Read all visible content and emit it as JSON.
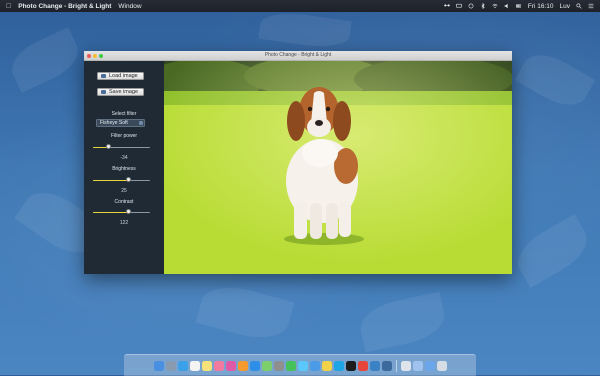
{
  "menubar": {
    "app_name": "Photo Change - Bright & Light",
    "menu_items": [
      "Window"
    ],
    "clock": "Fri 16:10",
    "user": "Luv"
  },
  "window": {
    "title": "Photo Change - Bright & Light"
  },
  "sidebar": {
    "load_label": "Load image",
    "save_label": "Save image",
    "select_filter_label": "Select filter",
    "filter_selected": "Fisheye Soft",
    "filter_power": {
      "label": "Filter power",
      "value": "-34",
      "fraction": 0.28
    },
    "brightness": {
      "label": "Brightness",
      "value": "25",
      "fraction": 0.63
    },
    "contrast": {
      "label": "Contrast",
      "value": "122",
      "fraction": 0.63
    }
  },
  "dock": {
    "apps": [
      {
        "name": "finder-icon",
        "color": "#4a90e2"
      },
      {
        "name": "launchpad-icon",
        "color": "#8a9bb0"
      },
      {
        "name": "safari-icon",
        "color": "#3aa0e8"
      },
      {
        "name": "calendar-icon",
        "color": "#f3f3f3"
      },
      {
        "name": "notes-icon",
        "color": "#f5e37a"
      },
      {
        "name": "photos-icon",
        "color": "#f07aa0"
      },
      {
        "name": "itunes-icon",
        "color": "#e05aa8"
      },
      {
        "name": "books-icon",
        "color": "#f59a2c"
      },
      {
        "name": "appstore-icon",
        "color": "#2d8fe8"
      },
      {
        "name": "maps-icon",
        "color": "#7ccf6b"
      },
      {
        "name": "system-prefs-icon",
        "color": "#8f8f8f"
      },
      {
        "name": "facetime-icon",
        "color": "#47c25a"
      },
      {
        "name": "messages-icon",
        "color": "#5ac8fa"
      },
      {
        "name": "mail-icon",
        "color": "#4c9be6"
      },
      {
        "name": "stickies-icon",
        "color": "#f1d34a"
      },
      {
        "name": "skype-icon",
        "color": "#1ea5e6"
      },
      {
        "name": "terminal-icon",
        "color": "#1c1c1c"
      },
      {
        "name": "chrome-icon",
        "color": "#e6453a"
      },
      {
        "name": "xcode-icon",
        "color": "#3b82c4"
      },
      {
        "name": "photo-change-icon",
        "color": "#3c6a9c"
      }
    ],
    "right": [
      {
        "name": "preview-icon",
        "color": "#dfe4ea"
      },
      {
        "name": "documents-icon",
        "color": "#9fc3ee"
      },
      {
        "name": "downloads-icon",
        "color": "#6aa6e9"
      },
      {
        "name": "trash-icon",
        "color": "#d6dde4"
      }
    ]
  }
}
